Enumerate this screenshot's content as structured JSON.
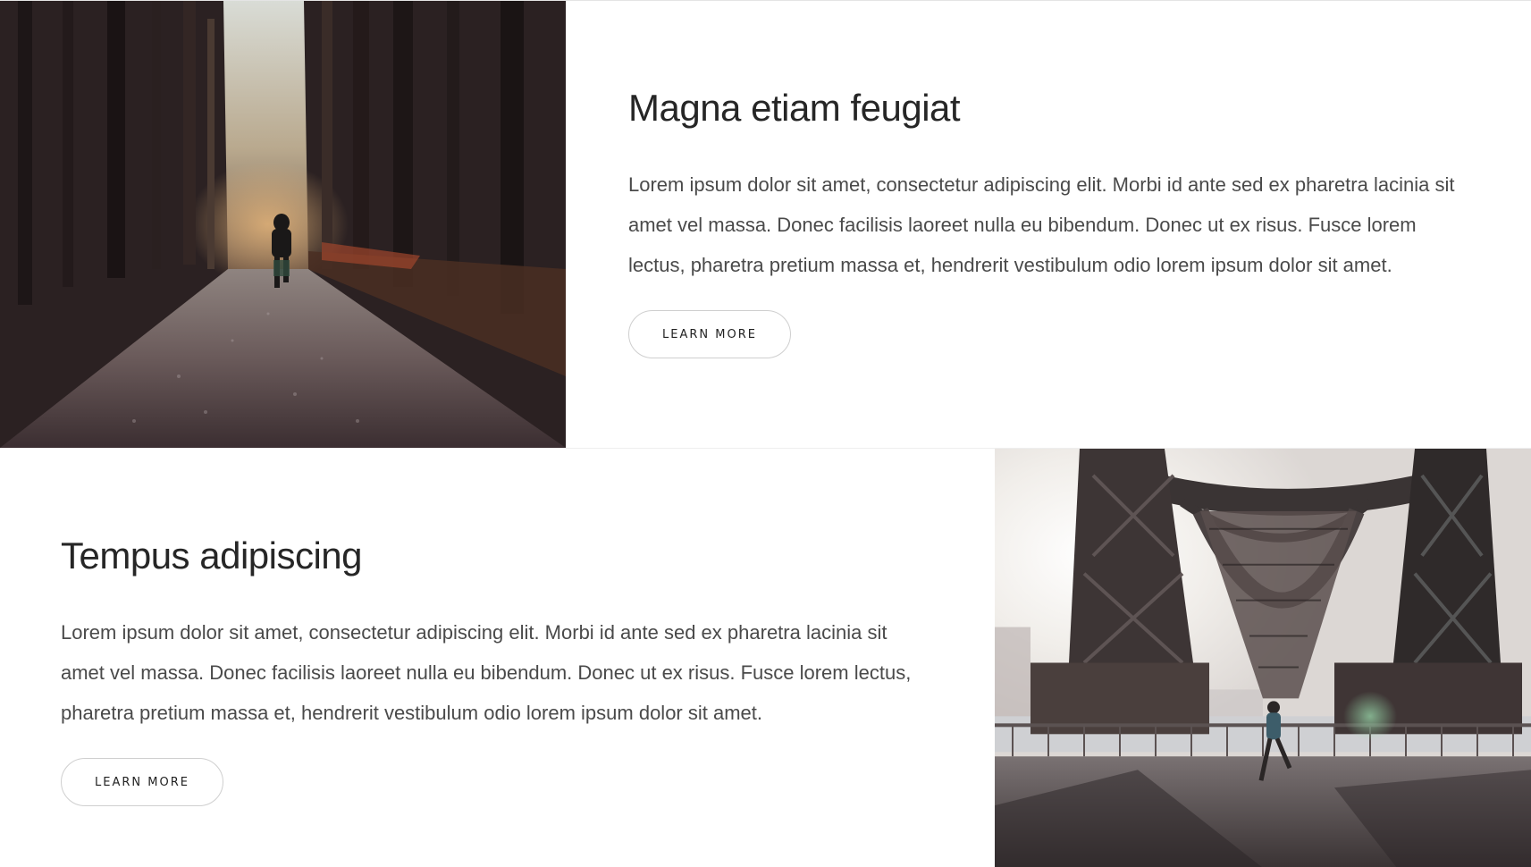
{
  "spotlights": [
    {
      "title": "Magna etiam feugiat",
      "text": "Lorem ipsum dolor sit amet, consectetur adipiscing elit. Morbi id ante sed ex pharetra lacinia sit amet vel massa. Donec facilisis laoreet nulla eu bibendum. Donec ut ex risus. Fusce lorem lectus, pharetra pretium massa et, hendrerit vestibulum odio lorem ipsum dolor sit amet.",
      "button_label": "LEARN MORE"
    },
    {
      "title": "Tempus adipiscing",
      "text": "Lorem ipsum dolor sit amet, consectetur adipiscing elit. Morbi id ante sed ex pharetra lacinia sit amet vel massa. Donec facilisis laoreet nulla eu bibendum. Donec ut ex risus. Fusce lorem lectus, pharetra pretium massa et, hendrerit vestibulum odio lorem ipsum dolor sit amet.",
      "button_label": "LEARN MORE"
    }
  ],
  "colors": {
    "forest_dark": "#2b2122",
    "sky_haze": "#e9e9e6",
    "bridge_steel": "#3a3434",
    "button_border": "#cfcfcf"
  }
}
